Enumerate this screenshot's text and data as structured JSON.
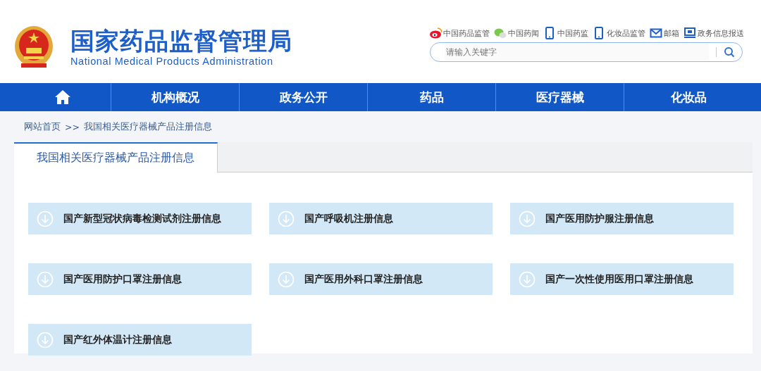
{
  "header": {
    "title": "国家药品监督管理局",
    "subtitle": "National Medical Products Administration",
    "links": [
      {
        "kind": "weibo",
        "label": "中国药品监管"
      },
      {
        "kind": "wechat",
        "label": "中国药闻"
      },
      {
        "kind": "phone",
        "label": "中国药监"
      },
      {
        "kind": "phone",
        "label": "化妆品监管"
      },
      {
        "kind": "mail",
        "label": "邮箱"
      },
      {
        "kind": "monitor",
        "label": "政务信息报送"
      }
    ],
    "search": {
      "placeholder": "请输入关键字"
    }
  },
  "nav": [
    {
      "kind": "home"
    },
    {
      "kind": "text",
      "label": "机构概况"
    },
    {
      "kind": "text",
      "label": "政务公开"
    },
    {
      "kind": "text",
      "label": "药品"
    },
    {
      "kind": "text",
      "label": "医疗器械"
    },
    {
      "kind": "text",
      "label": "化妆品"
    }
  ],
  "breadcrumb": [
    "网站首页",
    ">>",
    "我国相关医疗器械产品注册信息"
  ],
  "tabs": [
    {
      "label": "我国相关医疗器械产品注册信息",
      "selected": true
    }
  ],
  "items": [
    "国产新型冠状病毒检测试剂注册信息",
    "国产呼吸机注册信息",
    "国产医用防护服注册信息",
    "国产医用防护口罩注册信息",
    "国产医用外科口罩注册信息",
    "国产一次性使用医用口罩注册信息",
    "国产红外体温计注册信息"
  ]
}
